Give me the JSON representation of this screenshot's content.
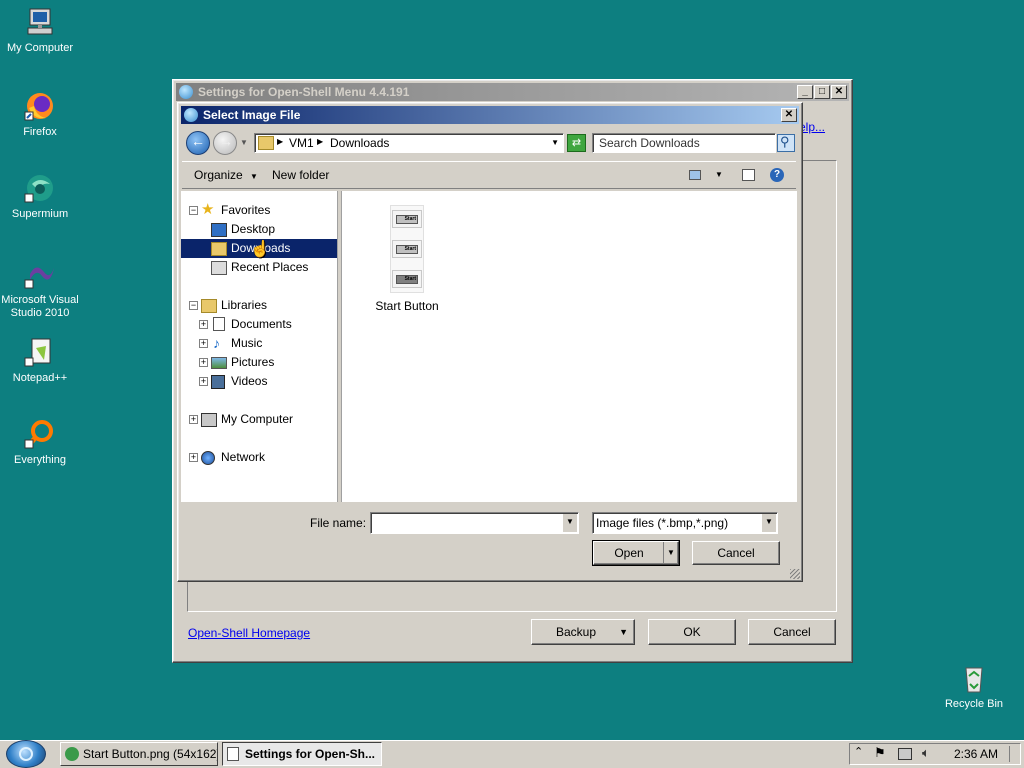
{
  "desktop": {
    "icons": [
      {
        "label": "My Computer",
        "icon": "computer-icon"
      },
      {
        "label": "Firefox",
        "icon": "firefox-icon"
      },
      {
        "label": "Supermium",
        "icon": "supermium-icon"
      },
      {
        "label": "Microsoft Visual Studio 2010",
        "icon": "visual-studio-icon"
      },
      {
        "label": "Notepad++",
        "icon": "notepadpp-icon"
      },
      {
        "label": "Everything",
        "icon": "everything-icon"
      },
      {
        "label": "Recycle Bin",
        "icon": "recycle-bin-icon"
      }
    ],
    "icon_lines": {
      "vs_line1": "Microsoft Visual",
      "vs_line2": "Studio 2010"
    }
  },
  "settings_window": {
    "title": "Settings for Open-Shell Menu 4.4.191",
    "help_link_fragment": "elp...",
    "homepage_link": "Open-Shell Homepage",
    "backup_label": "Backup",
    "ok_label": "OK",
    "cancel_label": "Cancel"
  },
  "dialog": {
    "title": "Select Image File",
    "breadcrumb": [
      "VM1",
      "Downloads"
    ],
    "search_placeholder": "Search Downloads",
    "organize_label": "Organize",
    "new_folder_label": "New folder",
    "tree": {
      "favorites": "Favorites",
      "desktop": "Desktop",
      "downloads": "Downloads",
      "recent_places": "Recent Places",
      "libraries": "Libraries",
      "documents": "Documents",
      "music": "Music",
      "pictures": "Pictures",
      "videos": "Videos",
      "my_computer": "My Computer",
      "network": "Network"
    },
    "selected_tree_item": "Downloads",
    "files": [
      {
        "name": "Start Button",
        "thumb_text": "Start"
      }
    ],
    "file_name_label": "File name:",
    "file_name_value": "",
    "file_type_value": "Image files (*.bmp,*.png)",
    "open_label": "Open",
    "cancel_label": "Cancel"
  },
  "taskbar": {
    "tasks": [
      {
        "label": "Start Button.png (54x162)...",
        "active": false
      },
      {
        "label": "Settings for Open-Sh...",
        "active": true
      }
    ],
    "clock": "2:36 AM"
  },
  "colors": {
    "desktop": "#0d7f80",
    "active_title_start": "#0a246a",
    "active_title_end": "#a6caf0",
    "selection": "#0a246a"
  }
}
